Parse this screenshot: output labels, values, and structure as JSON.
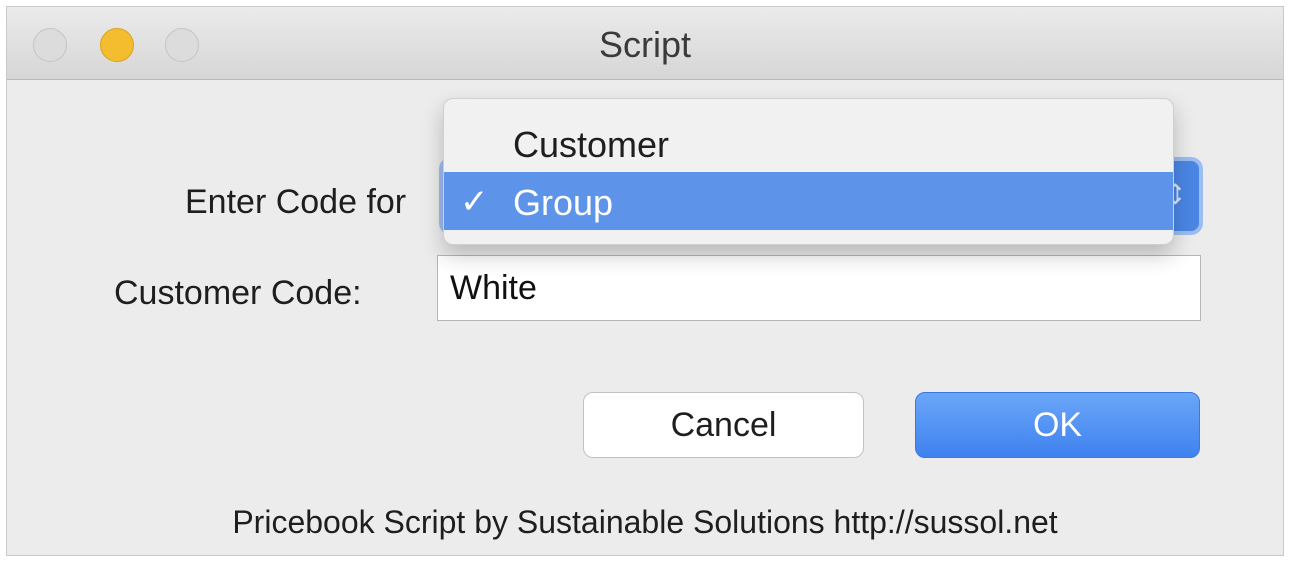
{
  "window": {
    "title": "Script"
  },
  "form": {
    "enter_code_label": "Enter Code for",
    "customer_code_label": "Customer Code:",
    "customer_code_value": "White"
  },
  "popup": {
    "selected_value": "Group",
    "arrows": "⇕",
    "options": [
      {
        "label": "Customer",
        "check": ""
      },
      {
        "label": "Group",
        "check": "✓"
      }
    ]
  },
  "buttons": {
    "cancel_label": "Cancel",
    "ok_label": "OK"
  },
  "footer": {
    "text": "Pricebook Script by Sustainable Solutions http://sussol.net"
  },
  "colors": {
    "accent": "#4b86e5",
    "highlight": "#5d93e8",
    "minimize_light": "#f3bd2f"
  }
}
